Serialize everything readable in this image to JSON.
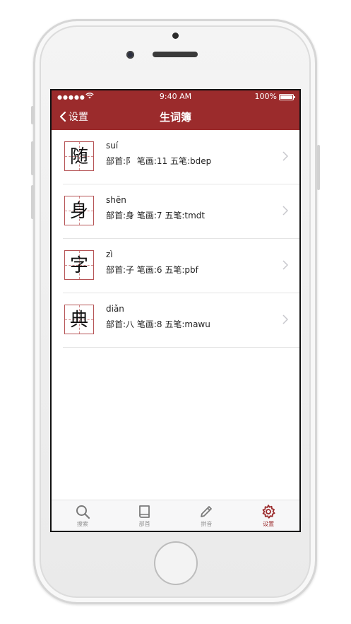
{
  "status_bar": {
    "signal": "●●●●●",
    "time": "9:40 AM",
    "battery": "100%"
  },
  "navbar": {
    "back_label": "设置",
    "title": "生词簿"
  },
  "words": [
    {
      "char": "随",
      "pinyin": "suí",
      "meta": "部首:阝 笔画:11 五笔:bdep"
    },
    {
      "char": "身",
      "pinyin": "shēn",
      "meta": "部首:身 笔画:7 五笔:tmdt"
    },
    {
      "char": "字",
      "pinyin": "zì",
      "meta": "部首:子 笔画:6 五笔:pbf"
    },
    {
      "char": "典",
      "pinyin": "diǎn",
      "meta": "部首:八 笔画:8 五笔:mawu"
    }
  ],
  "tabs": [
    {
      "label": "搜索",
      "icon": "search-icon",
      "active": false
    },
    {
      "label": "部首",
      "icon": "book-icon",
      "active": false
    },
    {
      "label": "拼音",
      "icon": "pencil-icon",
      "active": false
    },
    {
      "label": "设置",
      "icon": "gear-icon",
      "active": true
    }
  ],
  "colors": {
    "accent": "#9b2b2c",
    "tab_inactive": "#8e8e8e"
  }
}
